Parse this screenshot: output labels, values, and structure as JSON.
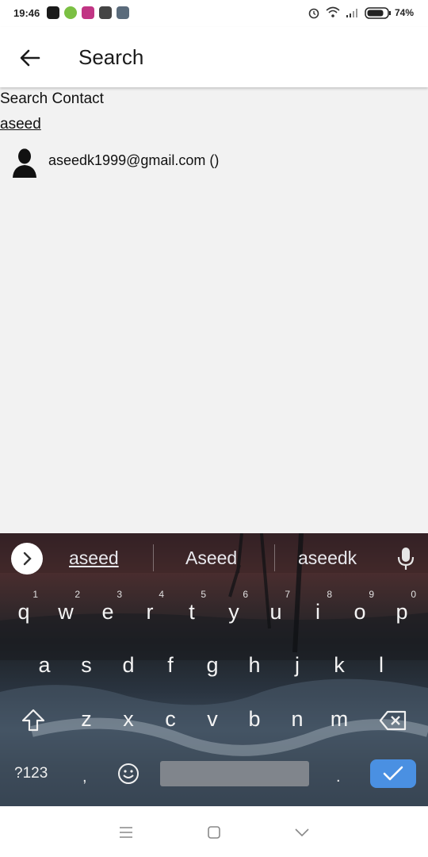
{
  "status_bar": {
    "time": "19:46",
    "battery": "74%"
  },
  "app_bar": {
    "title": "Search",
    "back_icon": "arrow-left-icon"
  },
  "content": {
    "search_label": "Search Contact",
    "query": "aseed",
    "results": [
      {
        "text": "aseedk1999@gmail.com ()",
        "icon": "person-silhouette-icon"
      }
    ]
  },
  "keyboard": {
    "suggestions": [
      "aseed",
      "Aseed",
      "aseedk"
    ],
    "row1": [
      {
        "key": "q",
        "hint": "1"
      },
      {
        "key": "w",
        "hint": "2"
      },
      {
        "key": "e",
        "hint": "3"
      },
      {
        "key": "r",
        "hint": "4"
      },
      {
        "key": "t",
        "hint": "5"
      },
      {
        "key": "y",
        "hint": "6"
      },
      {
        "key": "u",
        "hint": "7"
      },
      {
        "key": "i",
        "hint": "8"
      },
      {
        "key": "o",
        "hint": "9"
      },
      {
        "key": "p",
        "hint": "0"
      }
    ],
    "row2": [
      "a",
      "s",
      "d",
      "f",
      "g",
      "h",
      "j",
      "k",
      "l"
    ],
    "row3": [
      "z",
      "x",
      "c",
      "v",
      "b",
      "n",
      "m"
    ],
    "symbols_label": "?123",
    "comma": ",",
    "period": ".",
    "enter_color": "#4a90e2"
  },
  "nav_bar": {
    "icons": [
      "menu-lines-icon",
      "home-square-icon",
      "back-chevron-icon"
    ]
  }
}
